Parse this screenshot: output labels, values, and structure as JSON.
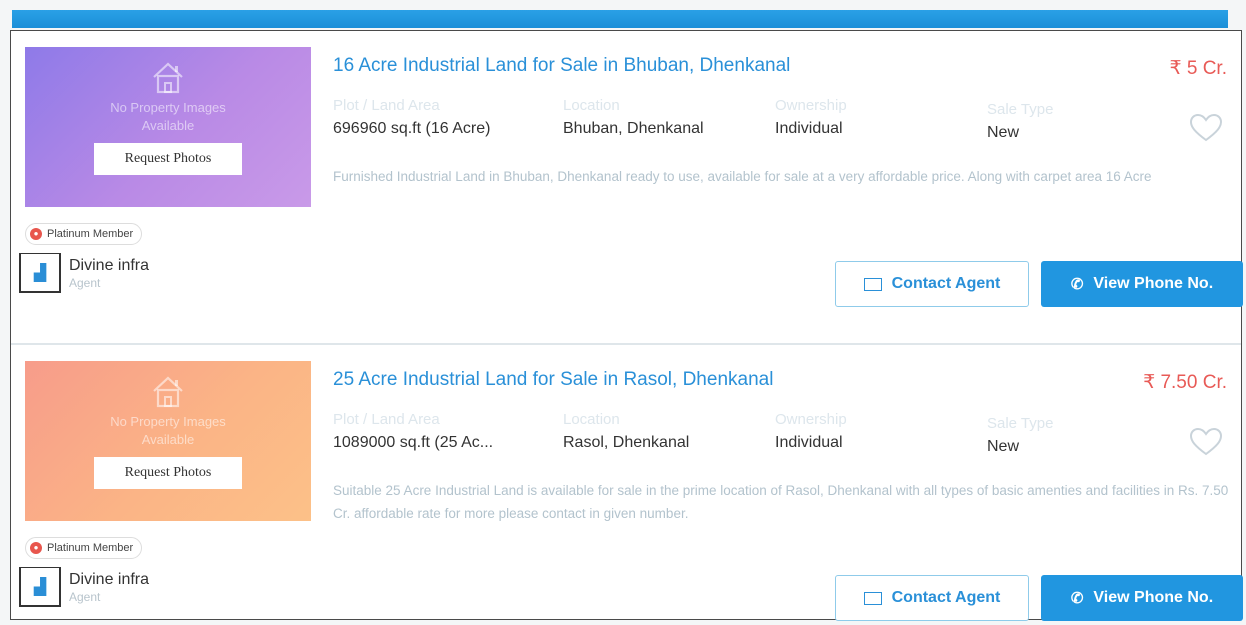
{
  "listings": [
    {
      "title": "16 Acre Industrial Land for Sale in Bhuban, Dhenkanal",
      "price": "₹ 5 Cr.",
      "no_image_text": "No Property Images Available",
      "request_photos_label": "Request Photos",
      "fields": [
        {
          "label": "Plot / Land Area",
          "value": "696960 sq.ft (16 Acre)"
        },
        {
          "label": "Location",
          "value": "Bhuban, Dhenkanal"
        },
        {
          "label": "Ownership",
          "value": "Individual"
        },
        {
          "label": "Sale Type",
          "value": "New"
        }
      ],
      "description": "Furnished Industrial Land in Bhuban, Dhenkanal ready to use, available for sale at a very affordable price. Along with carpet area 16 Acre",
      "badge": "Platinum Member",
      "agent_name": "Divine infra",
      "agent_role": "Agent",
      "contact_label": "Contact Agent",
      "phone_label": "View Phone No."
    },
    {
      "title": "25 Acre Industrial Land for Sale in Rasol, Dhenkanal",
      "price": "₹ 7.50 Cr.",
      "no_image_text": "No Property Images Available",
      "request_photos_label": "Request Photos",
      "fields": [
        {
          "label": "Plot / Land Area",
          "value": "1089000 sq.ft (25 Ac..."
        },
        {
          "label": "Location",
          "value": "Rasol, Dhenkanal"
        },
        {
          "label": "Ownership",
          "value": "Individual"
        },
        {
          "label": "Sale Type",
          "value": "New"
        }
      ],
      "description": "Suitable 25 Acre Industrial Land is available for sale in the prime location of Rasol, Dhenkanal with all types of basic amenties and facilities in Rs. 7.50 Cr. affordable rate for more please contact in given number.",
      "badge": "Platinum Member",
      "agent_name": "Divine infra",
      "agent_role": "Agent",
      "contact_label": "Contact Agent",
      "phone_label": "View Phone No."
    }
  ],
  "colors": {
    "accent": "#2196e0",
    "title": "#2a90d8",
    "price": "#e85a56",
    "badge_dot": "#e8564d"
  },
  "icons": [
    "house-icon",
    "heart-icon",
    "mail-icon",
    "phone-icon",
    "agent-logo-icon",
    "platinum-badge-icon"
  ]
}
